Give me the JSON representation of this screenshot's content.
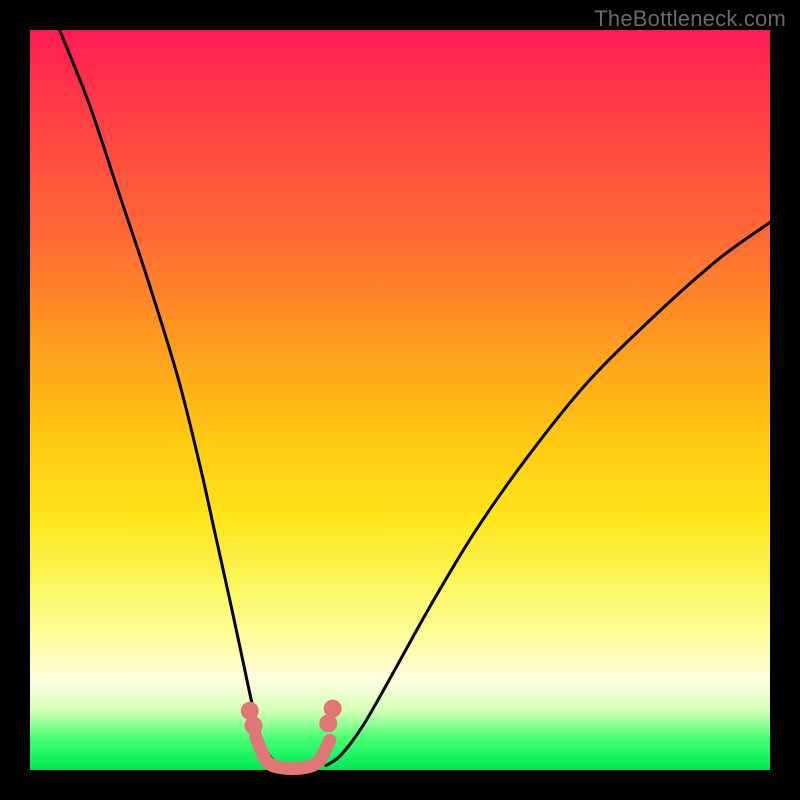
{
  "watermark": "TheBottleneck.com",
  "chart_data": {
    "type": "line",
    "title": "",
    "xlabel": "",
    "ylabel": "",
    "xlim": [
      0,
      100
    ],
    "ylim": [
      0,
      100
    ],
    "grid": false,
    "legend": false,
    "series": [
      {
        "name": "left-curve",
        "stroke": "#000000",
        "x": [
          4,
          8,
          12,
          16,
          20,
          23,
          25,
          27,
          28.5,
          30,
          31,
          32,
          33,
          34
        ],
        "y": [
          100,
          90,
          78,
          66,
          53,
          41,
          32,
          23,
          16,
          9,
          5,
          2.5,
          1.2,
          0.6
        ]
      },
      {
        "name": "right-curve",
        "stroke": "#000000",
        "x": [
          40,
          42,
          45,
          49,
          54,
          60,
          67,
          75,
          84,
          93,
          100
        ],
        "y": [
          0.6,
          2,
          6,
          13,
          22,
          32,
          42,
          52,
          61,
          69,
          74
        ]
      },
      {
        "name": "valley-arc",
        "stroke": "#e07676",
        "x": [
          30.5,
          32,
          34,
          37,
          39,
          40.5
        ],
        "y": [
          4.5,
          1.2,
          0.3,
          0.3,
          1.2,
          4.0
        ]
      }
    ],
    "markers": [
      {
        "name": "left-dot-1",
        "x": 29.7,
        "y": 8.0,
        "color": "#e07676"
      },
      {
        "name": "left-dot-2",
        "x": 30.2,
        "y": 6.0,
        "color": "#e07676"
      },
      {
        "name": "right-dot-1",
        "x": 40.3,
        "y": 6.3,
        "color": "#e07676"
      },
      {
        "name": "right-dot-2",
        "x": 40.9,
        "y": 8.3,
        "color": "#e07676"
      }
    ],
    "colors": {
      "gradient_top": "#ff1b54",
      "gradient_mid": "#ffe51a",
      "gradient_bottom": "#00e859",
      "curve": "#000000",
      "marker": "#e07676",
      "frame": "#000000"
    }
  }
}
